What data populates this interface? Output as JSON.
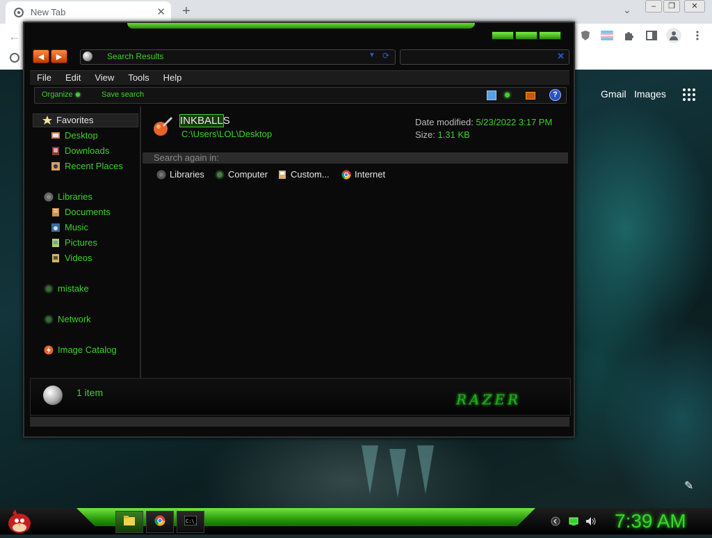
{
  "browser": {
    "tab_title": "New Tab",
    "tab_close": "✕",
    "new_tab": "+",
    "tab_search": "⌄",
    "back": "←",
    "ntp_links": {
      "gmail": "Gmail",
      "images": "Images"
    }
  },
  "explorer": {
    "address": "Search Results",
    "menu": [
      "File",
      "Edit",
      "View",
      "Tools",
      "Help"
    ],
    "commands": {
      "organize": "Organize",
      "save_search": "Save search",
      "help": "?"
    },
    "sidebar": {
      "favorites": "Favorites",
      "favorites_items": [
        "Desktop",
        "Downloads",
        "Recent Places"
      ],
      "libraries": "Libraries",
      "library_items": [
        "Documents",
        "Music",
        "Pictures",
        "Videos"
      ],
      "mistake": "mistake",
      "network": "Network",
      "image_catalog": "Image Catalog"
    },
    "result": {
      "name_highlight": "INKBALL",
      "name_rest": "S",
      "path": "C:\\Users\\LOL\\Desktop",
      "date_label": "Date modified:",
      "date_value": "5/23/2022 3:17 PM",
      "size_label": "Size:",
      "size_value": "1.31 KB"
    },
    "search_again": "Search again in:",
    "locations": [
      "Libraries",
      "Computer",
      "Custom...",
      "Internet"
    ],
    "status": "1 item",
    "brand": "RAZER"
  },
  "taskbar": {
    "clock": "7:39 AM"
  },
  "colors": {
    "accent": "#3ed12a",
    "window_bg": "#0a0a0a"
  }
}
